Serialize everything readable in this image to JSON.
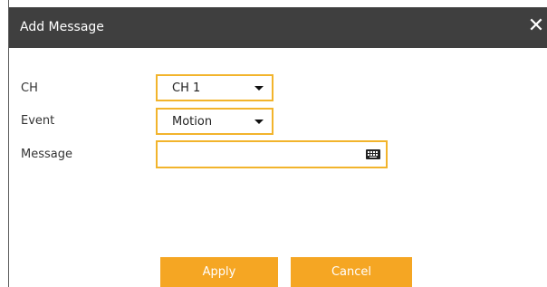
{
  "dialog": {
    "title": "Add Message",
    "close_icon": "close-icon"
  },
  "form": {
    "ch_label": "CH",
    "ch_value": "CH 1",
    "event_label": "Event",
    "event_value": "Motion",
    "message_label": "Message",
    "message_value": "",
    "keyboard_icon": "keyboard-icon"
  },
  "buttons": {
    "apply": "Apply",
    "cancel": "Cancel"
  },
  "colors": {
    "titlebar": "#3f3f3f",
    "accent_border": "#f2b42c",
    "button": "#f5a623"
  }
}
